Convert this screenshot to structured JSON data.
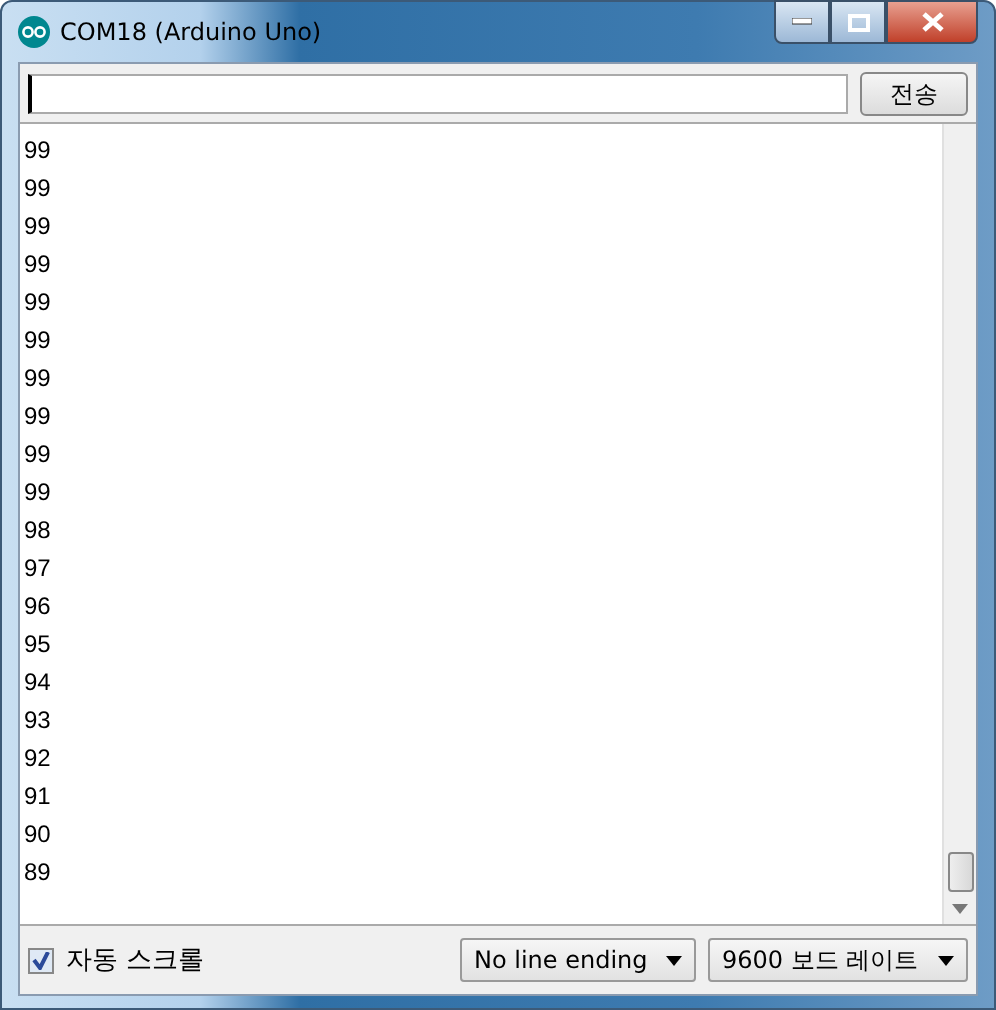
{
  "window": {
    "title": "COM18 (Arduino Uno)"
  },
  "send_button": {
    "label": "전송"
  },
  "output_lines": [
    "99",
    "99",
    "99",
    "99",
    "99",
    "99",
    "99",
    "99",
    "99",
    "99",
    "98",
    "97",
    "96",
    "95",
    "94",
    "93",
    "92",
    "91",
    "90",
    "89"
  ],
  "autoscroll": {
    "label": "자동 스크롤",
    "checked": true
  },
  "line_ending": {
    "value": "No line ending"
  },
  "baud_rate": {
    "value": "9600 보드 레이트"
  }
}
